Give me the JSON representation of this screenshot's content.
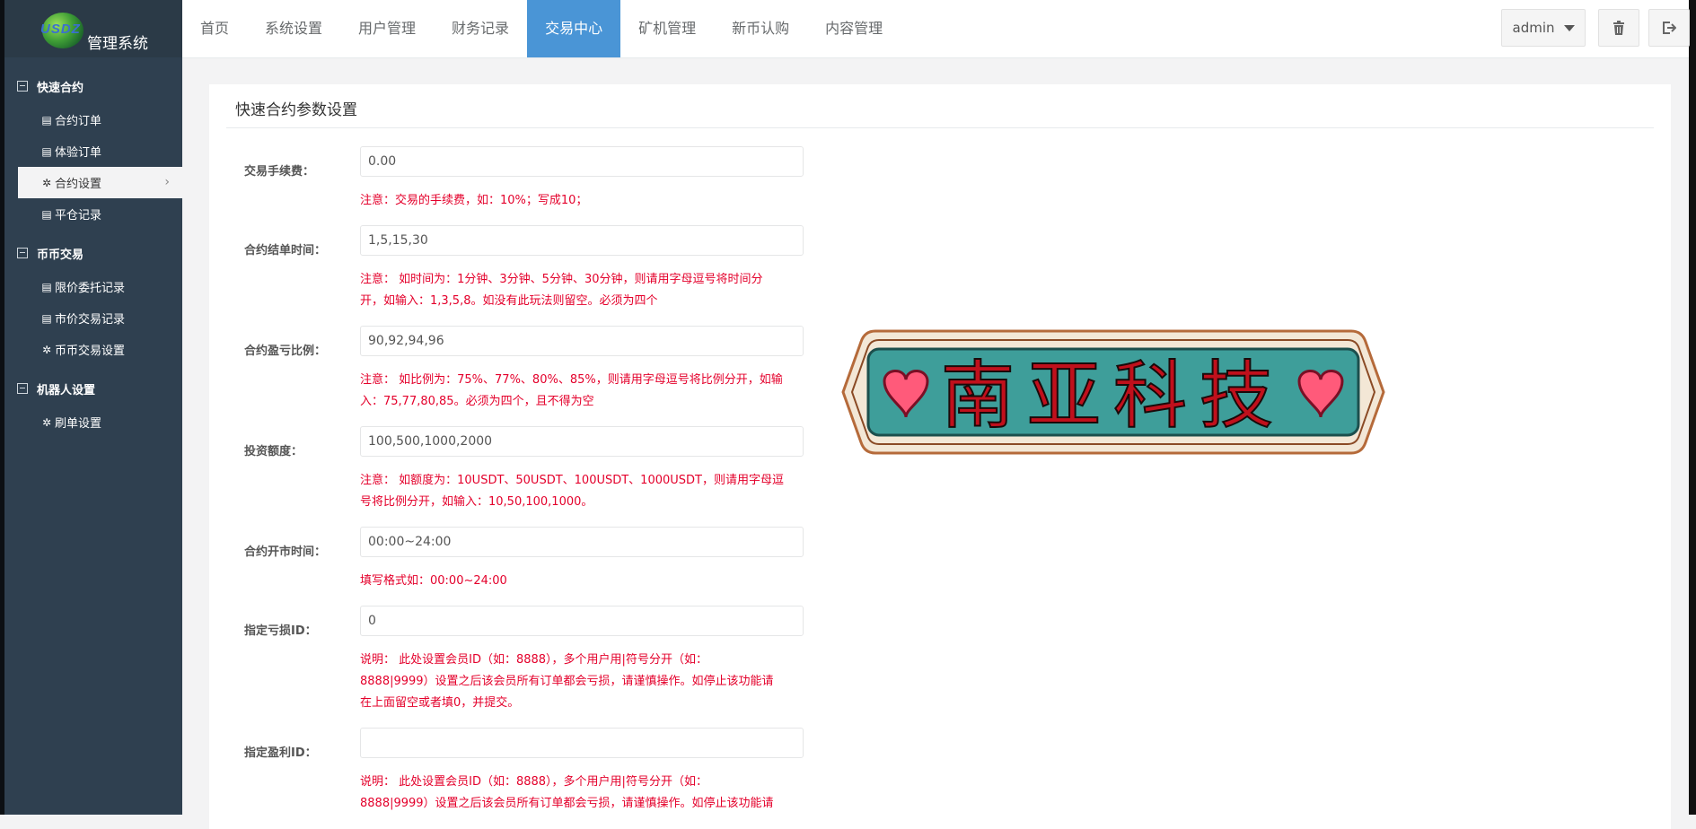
{
  "brand": {
    "logo_mark": "USDZ",
    "title": "管理系统"
  },
  "nav": {
    "items": [
      "首页",
      "系统设置",
      "用户管理",
      "财务记录",
      "交易中心",
      "矿机管理",
      "新币认购",
      "内容管理"
    ],
    "active_index": 4
  },
  "user_menu": {
    "label": "admin"
  },
  "sidebar": {
    "groups": [
      {
        "title": "快速合约",
        "items": [
          "合约订单",
          "体验订单",
          "合约设置",
          "平仓记录"
        ],
        "active_item": "合约设置"
      },
      {
        "title": "币币交易",
        "items": [
          "限价委托记录",
          "市价交易记录",
          "币币交易设置"
        ]
      },
      {
        "title": "机器人设置",
        "items": [
          "刷单设置"
        ]
      }
    ]
  },
  "panel": {
    "title": "快速合约参数设置",
    "fields": [
      {
        "label": "交易手续费：",
        "value": "0.00",
        "note": [
          "注意：交易的手续费，如：10%；写成10；"
        ]
      },
      {
        "label": "合约结单时间：",
        "value": "1,5,15,30",
        "note": [
          "注意： 如时间为：1分钟、3分钟、5分钟、30分钟，则请用字母逗号将时间分",
          "开，如输入：1,3,5,8。如没有此玩法则留空。必须为四个"
        ]
      },
      {
        "label": "合约盈亏比例：",
        "value": "90,92,94,96",
        "note": [
          "注意： 如比例为：75%、77%、80%、85%，则请用字母逗号将比例分开，如输",
          "入：75,77,80,85。必须为四个，且不得为空"
        ]
      },
      {
        "label": "投资额度：",
        "value": "100,500,1000,2000",
        "note": [
          "注意： 如额度为：10USDT、50USDT、100USDT、1000USDT，则请用字母逗",
          "号将比例分开，如输入：10,50,100,1000。"
        ]
      },
      {
        "label": "合约开市时间：",
        "value": "00:00~24:00",
        "note": [
          "填写格式如：00:00~24:00"
        ]
      },
      {
        "label": "指定亏损ID：",
        "value": "0",
        "note": [
          "说明： 此处设置会员ID（如：8888），多个用户用|符号分开（如：",
          "8888|9999）设置之后该会员所有订单都会亏损，请谨慎操作。如停止该功能请",
          "在上面留空或者填0，并提交。"
        ]
      },
      {
        "label": "指定盈利ID：",
        "value": "",
        "note": [
          "说明： 此处设置会员ID（如：8888），多个用户用|符号分开（如：",
          "8888|9999）设置之后该会员所有订单都会亏损，请谨慎操作。如停止该功能请"
        ]
      }
    ]
  },
  "watermark": {
    "text": "南亚科技",
    "colors": {
      "fill": "#3e9e9a",
      "text": "#c0101c",
      "heart": "#ff5a7a",
      "frame": "#b56a3a"
    }
  },
  "colors": {
    "sidebar": "#2f4050",
    "nav_active": "#4a95d6",
    "note": "#e4002b"
  }
}
